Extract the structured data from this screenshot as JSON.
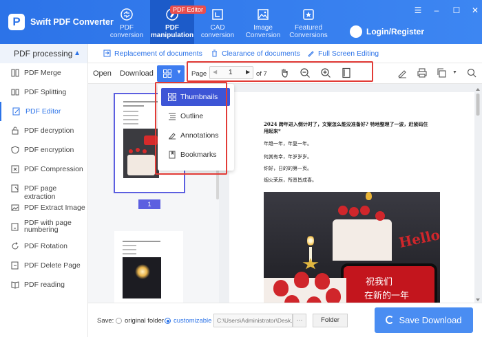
{
  "app": {
    "title": "Swift PDF Converter",
    "logo_letter": "P"
  },
  "nav": {
    "tabs": [
      {
        "label_line1": "PDF",
        "label_line2": "conversion"
      },
      {
        "label_line1": "PDF",
        "label_line2": "manipulation"
      },
      {
        "label_line1": "CAD",
        "label_line2": "conversion"
      },
      {
        "label_line1": "Image",
        "label_line2": "Conversion"
      },
      {
        "label_line1": "Featured",
        "label_line2": "Conversions"
      }
    ],
    "badge": "PDF Editor",
    "login": "Login/Register"
  },
  "sidebar": {
    "header": "PDF processing",
    "items": [
      {
        "label": "PDF Merge"
      },
      {
        "label": "PDF Splitting"
      },
      {
        "label": "PDF Editor"
      },
      {
        "label": "PDF decryption"
      },
      {
        "label": "PDF encryption"
      },
      {
        "label": "PDF Compression"
      },
      {
        "label": "PDF page extraction"
      },
      {
        "label": "PDF Extract Image"
      },
      {
        "label_line1": "PDF with page",
        "label_line2": "numbering"
      },
      {
        "label": "PDF Rotation"
      },
      {
        "label": "PDF Delete Page"
      },
      {
        "label": "PDF reading"
      }
    ]
  },
  "toolbar": {
    "replacement": "Replacement of documents",
    "clearance": "Clearance of documents",
    "fullscreen": "Full Screen Editing",
    "open": "Open",
    "download": "Download",
    "page_label": "Page",
    "page_value": "1",
    "page_total": "of 7"
  },
  "dropdown": {
    "items": [
      "Thumbnails",
      "Outline",
      "Annotations",
      "Bookmarks"
    ]
  },
  "thumbnails": {
    "first_page_number": "1"
  },
  "document": {
    "lines": [
      "2024 跨年进入倒计时了，文案怎么能没准备好? 特地整理了一波，赶紧码住",
      "用起来*",
      "年趋一年，年复一年。",
      "何其有幸，年岁岁岁。",
      "你好，日的的第一页。",
      "烟火荣辰，所愿皆成喜。"
    ],
    "photo_text_1": "祝我们",
    "photo_text_2": "在新的一年",
    "photo_text_hello": "Hello"
  },
  "footer": {
    "save_label": "Save:",
    "original_folder": "original folder",
    "customizable": "customizable",
    "path": "C:\\Users\\Administrator\\Desk...",
    "dots": "···",
    "folder": "Folder",
    "save_download": "Save Download"
  },
  "colors": {
    "primary": "#2c73e8",
    "highlight_box": "#e23b36",
    "dropdown_active": "#3d55d6",
    "page_badge": "#5c5fe0"
  }
}
